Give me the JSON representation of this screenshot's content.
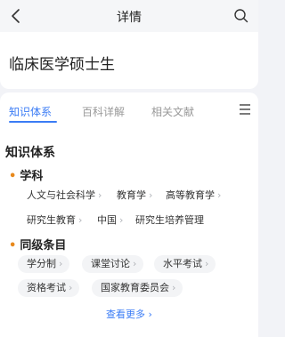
{
  "header": {
    "title": "详情"
  },
  "page_title": "临床医学硕士生",
  "tabs": [
    {
      "label": "知识体系"
    },
    {
      "label": "百科详解"
    },
    {
      "label": "相关文献"
    }
  ],
  "section_title": "知识体系",
  "group_subject": {
    "title": "学科",
    "items": [
      "人文与社会科学",
      "教育学",
      "高等教育学",
      "研究生教育",
      "中国",
      "研究生培养管理"
    ]
  },
  "group_peer": {
    "title": "同级条目",
    "items": [
      "学分制",
      "课堂讨论",
      "水平考试",
      "资格考试",
      "国家教育委员会"
    ]
  },
  "see_more": "查看更多",
  "colors": {
    "accent": "#3b7cf5",
    "bullet": "#e8891c"
  },
  "icons": [
    "back-arrow-icon",
    "search-icon",
    "menu-icon",
    "chevron-right-icon"
  ]
}
